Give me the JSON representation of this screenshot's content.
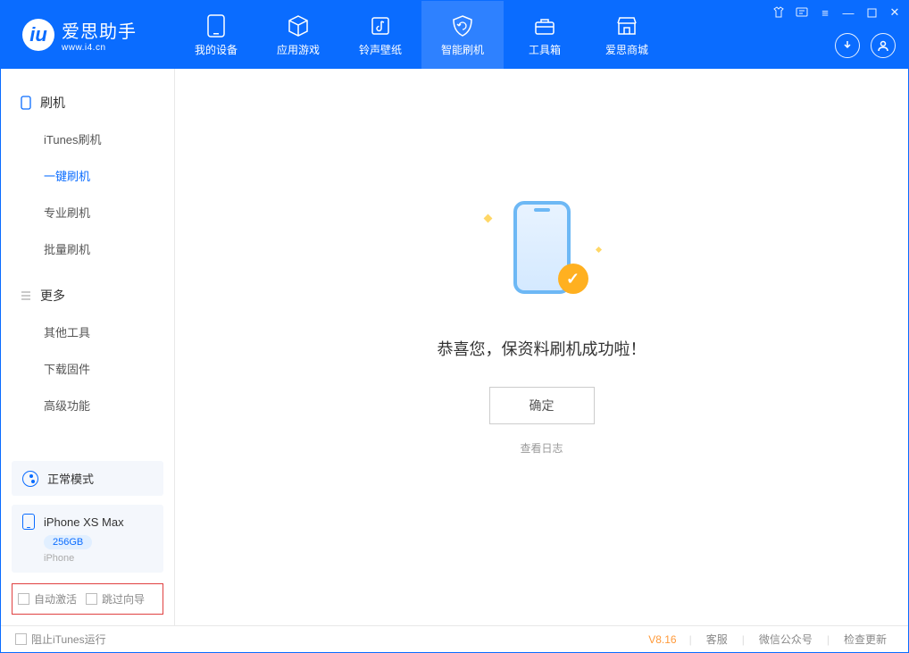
{
  "app": {
    "title": "爱思助手",
    "subtitle": "www.i4.cn"
  },
  "tabs": [
    {
      "label": "我的设备"
    },
    {
      "label": "应用游戏"
    },
    {
      "label": "铃声壁纸"
    },
    {
      "label": "智能刷机"
    },
    {
      "label": "工具箱"
    },
    {
      "label": "爱思商城"
    }
  ],
  "sidebar": {
    "section1": {
      "title": "刷机"
    },
    "items1": [
      {
        "label": "iTunes刷机"
      },
      {
        "label": "一键刷机"
      },
      {
        "label": "专业刷机"
      },
      {
        "label": "批量刷机"
      }
    ],
    "section2": {
      "title": "更多"
    },
    "items2": [
      {
        "label": "其他工具"
      },
      {
        "label": "下载固件"
      },
      {
        "label": "高级功能"
      }
    ]
  },
  "device": {
    "mode": "正常模式",
    "name": "iPhone XS Max",
    "capacity": "256GB",
    "type": "iPhone"
  },
  "checkboxes": {
    "autoActivate": "自动激活",
    "skipGuide": "跳过向导"
  },
  "main": {
    "successTitle": "恭喜您，保资料刷机成功啦！",
    "okButton": "确定",
    "logLink": "查看日志"
  },
  "footer": {
    "blockItunes": "阻止iTunes运行",
    "version": "V8.16",
    "links": [
      "客服",
      "微信公众号",
      "检查更新"
    ]
  }
}
